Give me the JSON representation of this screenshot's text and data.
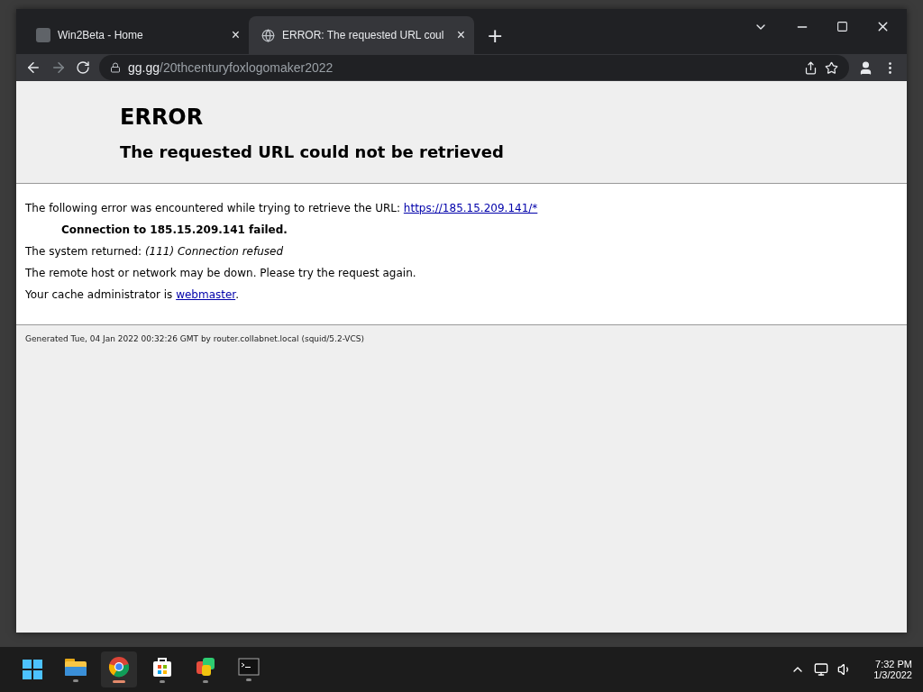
{
  "browser": {
    "tabs": [
      {
        "title": "Win2Beta - Home",
        "selected": false,
        "close": "×"
      },
      {
        "title": "ERROR: The requested URL coul",
        "selected": true,
        "close": "×"
      }
    ],
    "new_tab": "+",
    "address": {
      "host": "gg.gg",
      "path": "/20thcenturyfoxlogomaker2022"
    }
  },
  "page": {
    "title": "ERROR",
    "subtitle": "The requested URL could not be retrieved",
    "intro": "The following error was encountered while trying to retrieve the URL: ",
    "intro_link": "https://185.15.209.141/*",
    "failure": "Connection to 185.15.209.141 failed.",
    "system_label": "The system returned: ",
    "system_value": "(111) Connection refused",
    "advice": "The remote host or network may be down. Please try the request again.",
    "admin_text": "Your cache administrator is ",
    "admin_link": "webmaster",
    "admin_end": ".",
    "footer": "Generated Tue, 04 Jan 2022 00:32:26 GMT by router.collabnet.local (squid/5.2-VCS)"
  },
  "taskbar": {
    "apps": [
      {
        "kind": "start",
        "selected": false
      },
      {
        "kind": "folder",
        "selected": false
      },
      {
        "kind": "chrome",
        "selected": true
      },
      {
        "kind": "store",
        "selected": false
      },
      {
        "kind": "office",
        "selected": false
      },
      {
        "kind": "terminal",
        "selected": false
      }
    ],
    "time": "7:32 PM",
    "date": "1/3/2022"
  }
}
